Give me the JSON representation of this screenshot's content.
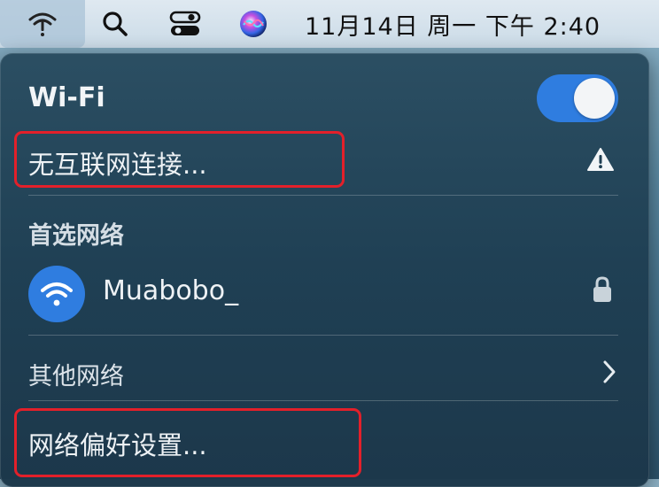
{
  "menubar": {
    "icons": [
      "wifi-warning-icon",
      "search-icon",
      "control-center-icon",
      "siri-icon"
    ],
    "datetime": "11月14日 周一 下午 2:40"
  },
  "wifi_panel": {
    "title": "Wi-Fi",
    "toggle_on": true,
    "status_text": "无互联网连接...",
    "status_icon": "warning-triangle-icon",
    "preferred_section": "首选网络",
    "networks": [
      {
        "name": "Muabobo_",
        "icon": "wifi-icon",
        "locked": true
      }
    ],
    "other_networks": "其他网络",
    "preferences": "网络偏好设置..."
  },
  "colors": {
    "accent": "#2f7de0",
    "highlight": "#e3202a"
  }
}
